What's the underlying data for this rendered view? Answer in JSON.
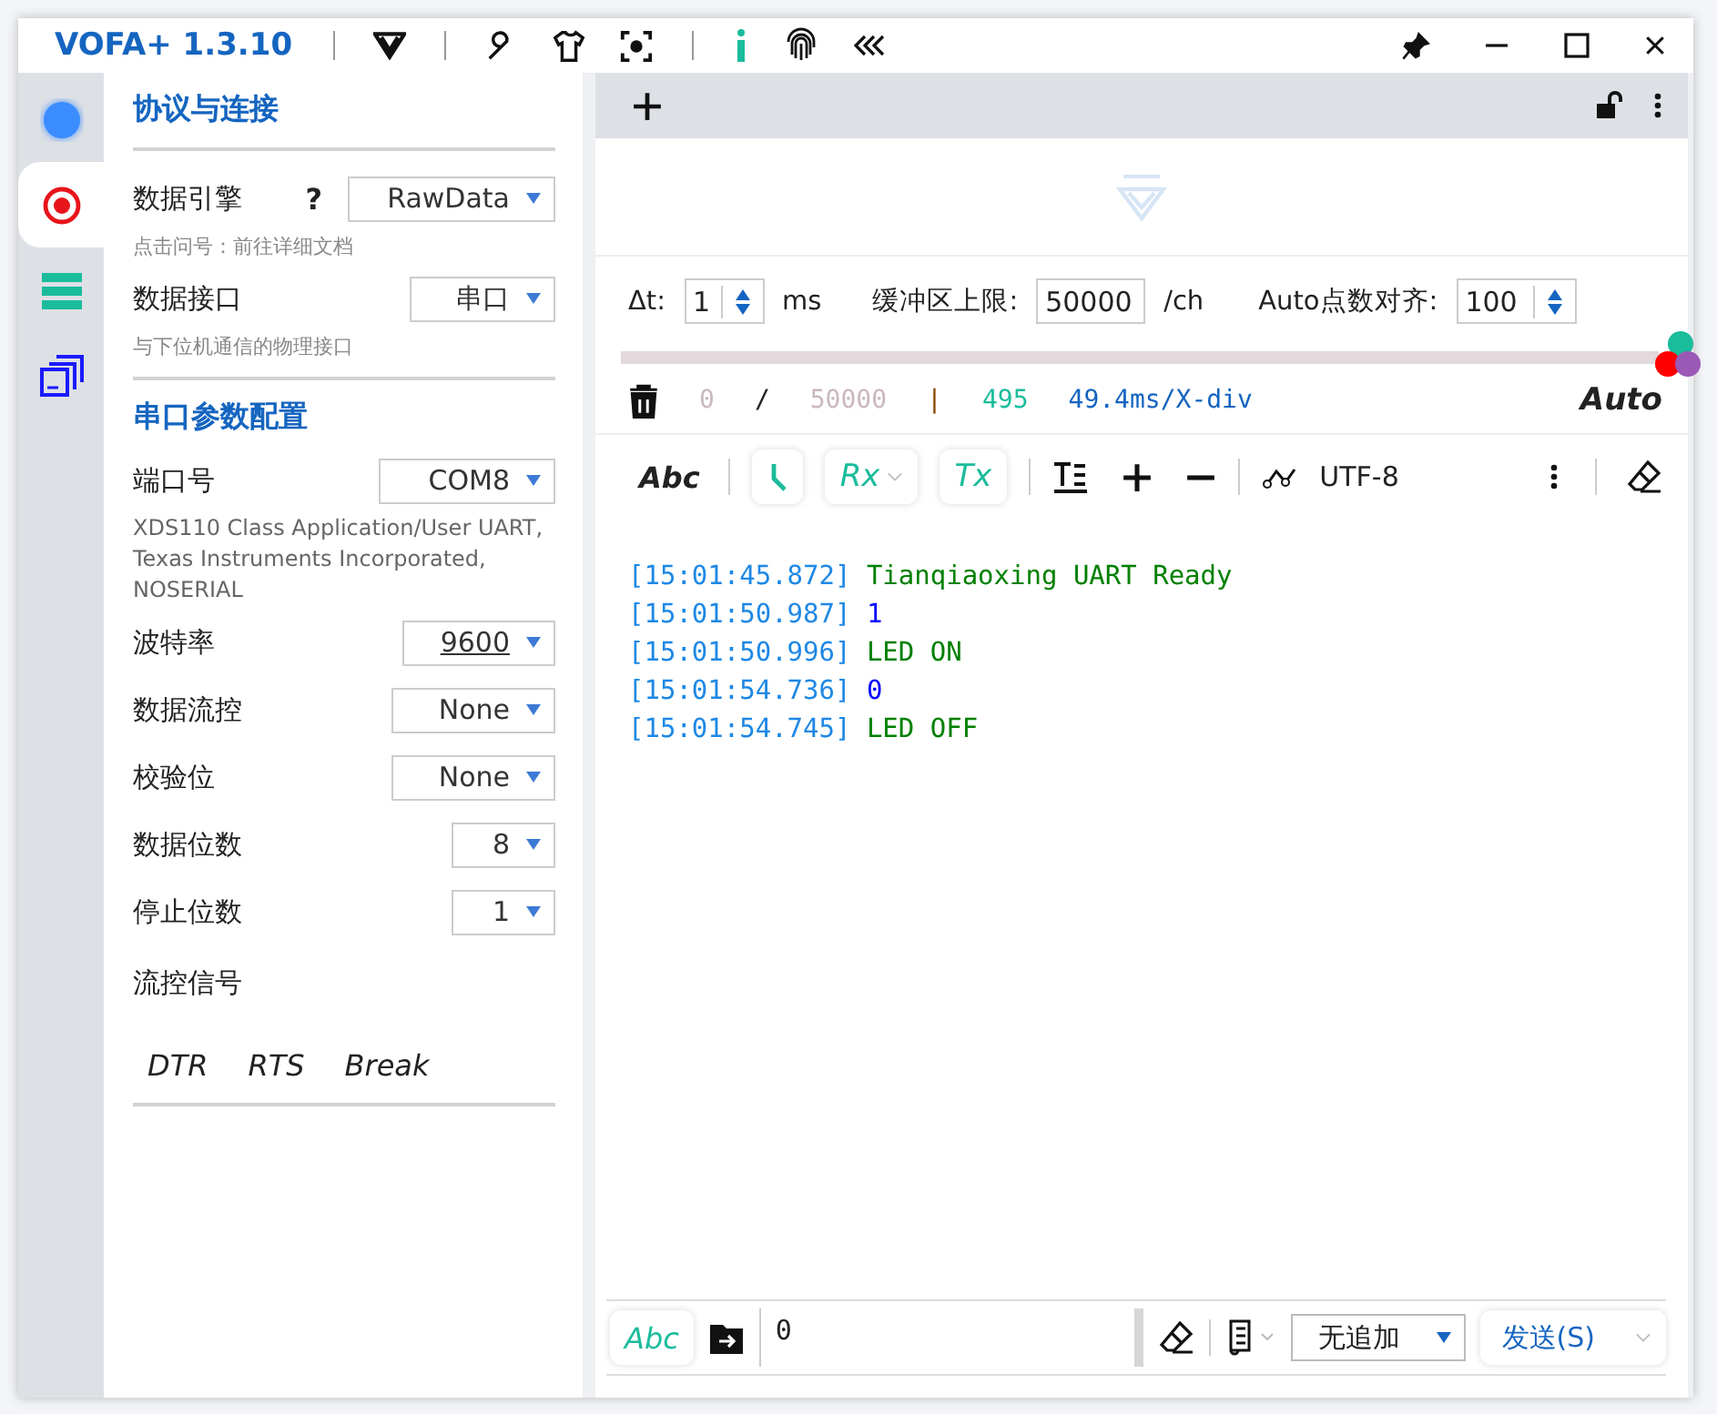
{
  "window": {
    "title": "VOFA+ 1.3.10"
  },
  "rail": [
    {
      "kind": "dot",
      "selected": false
    },
    {
      "kind": "record",
      "selected": true
    },
    {
      "kind": "stack",
      "selected": false
    },
    {
      "kind": "windows",
      "selected": false
    }
  ],
  "config": {
    "title": "协议与连接",
    "engine": {
      "label": "数据引擎",
      "help": "?",
      "value": "RawData",
      "hint": "点击问号：前往详细文档"
    },
    "interface": {
      "label": "数据接口",
      "value": "串口",
      "hint": "与下位机通信的物理接口"
    },
    "serial_title": "串口参数配置",
    "fields": [
      {
        "label": "端口号",
        "value": "COM8",
        "editable": false,
        "hint": "XDS110 Class Application/User UART, Texas Instruments Incorporated, NOSERIAL"
      },
      {
        "label": "波特率",
        "value": "9600",
        "editable": true
      },
      {
        "label": "数据流控",
        "value": "None",
        "editable": false
      },
      {
        "label": "校验位",
        "value": "None",
        "editable": false
      },
      {
        "label": "数据位数",
        "value": "8",
        "editable": false
      },
      {
        "label": "停止位数",
        "value": "1",
        "editable": false
      }
    ],
    "flow_label": "流控信号",
    "signals": [
      "DTR",
      "RTS",
      "Break"
    ]
  },
  "scope": {
    "delta_t": {
      "label": "Δt:",
      "value": "1",
      "unit": "ms"
    },
    "buffer": {
      "label": "缓冲区上限:",
      "value": "50000",
      "unit": "/ch"
    },
    "align": {
      "label": "Auto点数对齐:",
      "value": "100"
    },
    "channels": [
      {
        "color": "#1abc9c"
      },
      {
        "color": "#ff0000"
      },
      {
        "color": "#9b59b6"
      }
    ],
    "status": {
      "start": "0",
      "slash": "/",
      "end": "50000",
      "bar": "|",
      "count": "495",
      "scale": "49.4ms/X-div",
      "mode": "Auto"
    }
  },
  "terminal": {
    "format": "Abc",
    "rx": "Rx",
    "tx": "Tx",
    "encoding": "UTF-8",
    "lines": [
      {
        "time": "[15:01:45.872]",
        "text": "Tianqiaoxing UART Ready",
        "kind": "text"
      },
      {
        "time": "[15:01:50.987]",
        "text": "1",
        "kind": "number"
      },
      {
        "time": "[15:01:50.996]",
        "text": "LED ON",
        "kind": "text"
      },
      {
        "time": "[15:01:54.736]",
        "text": "0",
        "kind": "number"
      },
      {
        "time": "[15:01:54.745]",
        "text": "LED OFF",
        "kind": "text"
      }
    ]
  },
  "send": {
    "format": "Abc",
    "value": "0",
    "append": "无追加",
    "button": "发送(S)"
  }
}
